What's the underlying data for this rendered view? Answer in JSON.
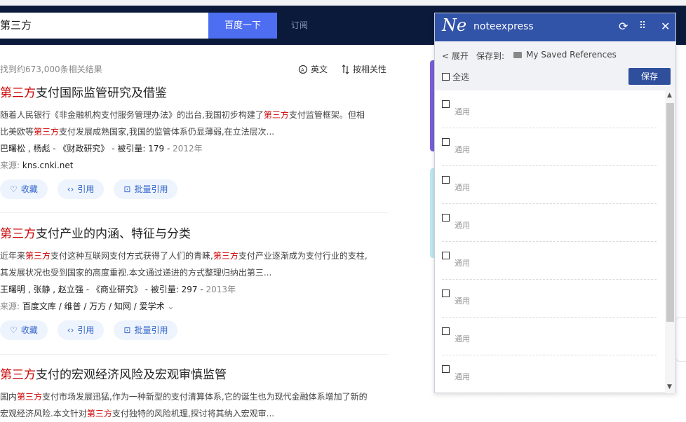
{
  "search": {
    "query": "第三方",
    "button": "百度一下",
    "tab": "订阅"
  },
  "results_meta": {
    "count": "找到约673,000条相关结果",
    "lang": "英文",
    "sort": "按相关性"
  },
  "results": [
    {
      "title_hl": "第三方",
      "title_rest": "支付国际监管研究及借鉴",
      "abs1_a": "随着人民银行《非金融机构支付服务管理办法》的出台,我国初步构建了",
      "abs1_hl": "第三方",
      "abs1_b": "支付监管框架。但相",
      "abs2_a": "比美欧等",
      "abs2_hl": "第三方",
      "abs2_b": "支付发展成熟国家,我国的监管体系仍显薄弱,在立法层次...",
      "authors": "巴曙松 ,  杨彪  -  《财政研究》  -  被引量: 179  - ",
      "year": "2012年",
      "src_label": "来源:",
      "src": "kns.cnki.net",
      "fav": "收藏",
      "cite": "引用",
      "batch": "批量引用"
    },
    {
      "title_hl": "第三方",
      "title_rest": "支付产业的内涵、特征与分类",
      "abs1_a": "近年来",
      "abs1_hl": "第三方",
      "abs1_b": "支付这种互联网支付方式获得了人们的青睐,",
      "abs1_hl2": "第三方",
      "abs1_c": "支付产业逐渐成为支付行业的支柱,",
      "abs2_a": "其发展状况也受到国家的高度重视.本文通过递进的方式整理归纳出第三...",
      "authors": "王曙明 ,  张静 ,  赵立强  -  《商业研究》  -  被引量: 297  - ",
      "year": "2013年",
      "src_label": "来源:",
      "src": "百度文库  /  维普  /  万方  /  知网  /  爱学术",
      "fav": "收藏",
      "cite": "引用",
      "batch": "批量引用"
    },
    {
      "title_hl": "第三方",
      "title_rest": "支付的宏观经济风险及宏观审慎监管",
      "abs1_a": "国内",
      "abs1_hl": "第三方",
      "abs1_b": "支付市场发展迅猛,作为一种新型的支付清算体系,它的诞生也为现代金融体系增加了新的",
      "abs2_a": "宏观经济风险.本文针对",
      "abs2_hl": "第三方",
      "abs2_b": "支付独特的风险机理,探讨将其纳入宏观审..."
    }
  ],
  "panel": {
    "logo": "Ne",
    "title": "noteexpress",
    "expand": "< 展开",
    "save_to": "保存到:",
    "folder": "My Saved References",
    "select_all": "全选",
    "save": "保存",
    "items": [
      "通用",
      "通用",
      "通用",
      "通用",
      "通用",
      "通用",
      "通用",
      "通用"
    ]
  },
  "colors": {
    "header": "#0b1a3a",
    "search_button": "#4e6ef2",
    "panel_header": "#3153a8",
    "highlight": "#cc0000"
  }
}
